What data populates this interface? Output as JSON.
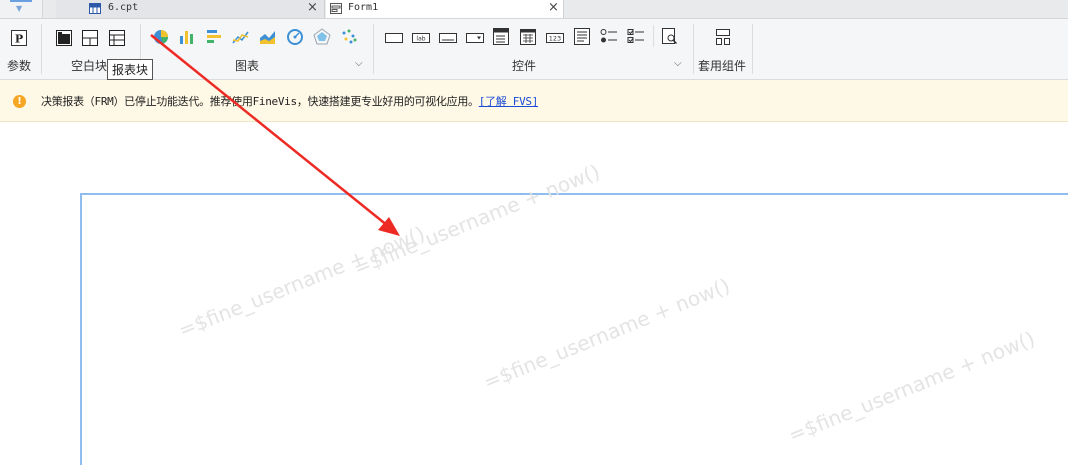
{
  "tabs": [
    {
      "label": "6.cpt"
    },
    {
      "label": "Form1"
    }
  ],
  "toolbar": {
    "groups": {
      "param": "参数",
      "blank": "空白块",
      "chart": "图表",
      "widget": "控件",
      "component": "套用组件"
    },
    "tooltip": "报表块",
    "param_icon": "P",
    "text_icon": "lab",
    "number_icon": "123"
  },
  "notice": {
    "text": "决策报表（FRM）已停止功能迭代。推荐使用FineVis，快速搭建更专业好用的可视化应用。",
    "link": "[了解 FVS]"
  },
  "watermark": {
    "text": "=$fine_username + now()"
  },
  "colors": {
    "accent": "#6a9fe0",
    "notice_bg": "#fef8e6",
    "arrow": "#ee2a24"
  }
}
